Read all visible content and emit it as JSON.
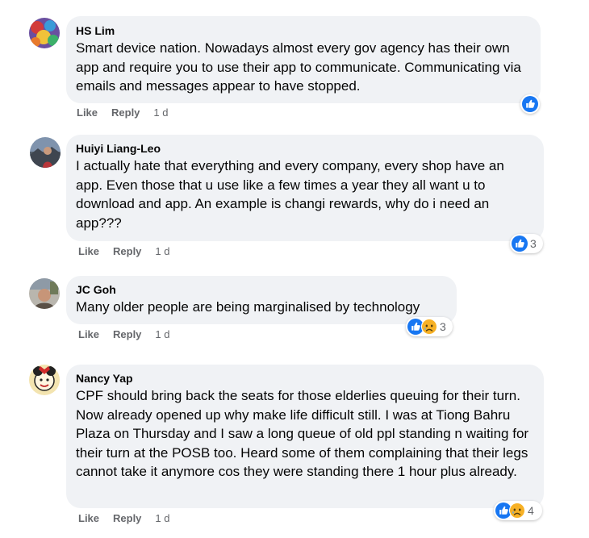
{
  "comments": [
    {
      "author": "HS Lim",
      "text": "Smart device nation. Nowadays almost every gov agency has their own app and require you to use their app to communicate. Communicating via emails and messages appear to have stopped.",
      "like_label": "Like",
      "reply_label": "Reply",
      "time": "1 d",
      "reactions": [
        "like-icon"
      ],
      "reaction_count": ""
    },
    {
      "author": "Huiyi Liang-Leo",
      "text": "I actually hate that everything and every company, every shop have an app. Even those that u use like a few times a year they all want u to download and app. An example is changi rewards, why do i need an app???",
      "like_label": "Like",
      "reply_label": "Reply",
      "time": "1 d",
      "reactions": [
        "like-icon"
      ],
      "reaction_count": "3"
    },
    {
      "author": "JC Goh",
      "text": "Many older people are being marginalised by technology",
      "like_label": "Like",
      "reply_label": "Reply",
      "time": "1 d",
      "reactions": [
        "like-icon",
        "sad-icon"
      ],
      "reaction_count": "3"
    },
    {
      "author": "Nancy Yap",
      "text": "CPF should bring back the seats for those elderlies queuing for their turn. Now already opened up why make life difficult still. I was at Tiong Bahru Plaza on Thursday and I saw a long queue of old ppl standing n waiting for their turn at the POSB too. Heard some of them complaining that their legs cannot take it anymore cos they were standing there 1 hour plus already.",
      "like_label": "Like",
      "reply_label": "Reply",
      "time": "1 d",
      "reactions": [
        "like-icon",
        "sad-icon"
      ],
      "reaction_count": "4"
    }
  ],
  "colors": {
    "bubble": "#f0f2f5",
    "meta": "#65676b",
    "like": "#1877f2",
    "sad": "#f7b125"
  }
}
